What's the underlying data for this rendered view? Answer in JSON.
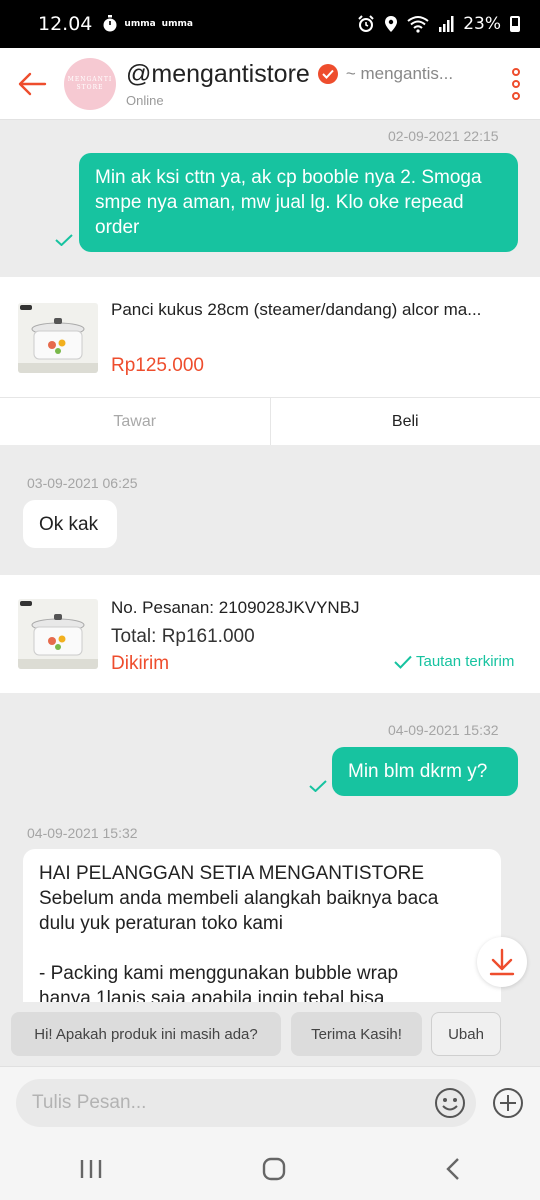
{
  "status": {
    "time": "12.04",
    "mini_labels": [
      "umma",
      "umma"
    ],
    "battery": "23%"
  },
  "header": {
    "avatar_line1": "MENGANTI",
    "avatar_line2": "STORE",
    "shop_name": "@mengantistore",
    "alias": "~ mengantis...",
    "status": "Online"
  },
  "messages": {
    "m1_time": "02-09-2021 22:15",
    "m1_text": "Min ak ksi cttn ya, ak cp booble nya 2. Smoga smpe nya aman, mw jual lg. Klo oke repead order",
    "product": {
      "name": "Panci kukus 28cm  (steamer/dandang) alcor ma...",
      "price": "Rp125.000",
      "offer_label": "Tawar",
      "buy_label": "Beli"
    },
    "m2_time": "03-09-2021 06:25",
    "m2_text": "Ok kak",
    "order": {
      "number": "No. Pesanan: 2109028JKVYNBJ",
      "total": "Total: Rp161.000",
      "state": "Dikirim",
      "link_status": "Tautan terkirim"
    },
    "m3_time": "04-09-2021 15:32",
    "m3_text": "Min blm dkrm y?",
    "m4_time": "04-09-2021 15:32",
    "m4_lines": [
      "HAI PELANGGAN SETIA MENGANTISTORE",
      "Sebelum anda membeli alangkah baiknya baca",
      "dulu yuk peraturan toko kami",
      "",
      "- Packing kami menggunakan bubble wrap",
      "hanya 1lapis saja apabila ingin tebal bisa"
    ]
  },
  "quick_replies": [
    "Hi! Apakah produk ini masih ada?",
    "Terima Kasih!",
    "Ubah"
  ],
  "input": {
    "placeholder": "Tulis Pesan..."
  },
  "colors": {
    "accent": "#ee4d2d",
    "bubble_out": "#17c3a0",
    "background": "#ececec"
  }
}
